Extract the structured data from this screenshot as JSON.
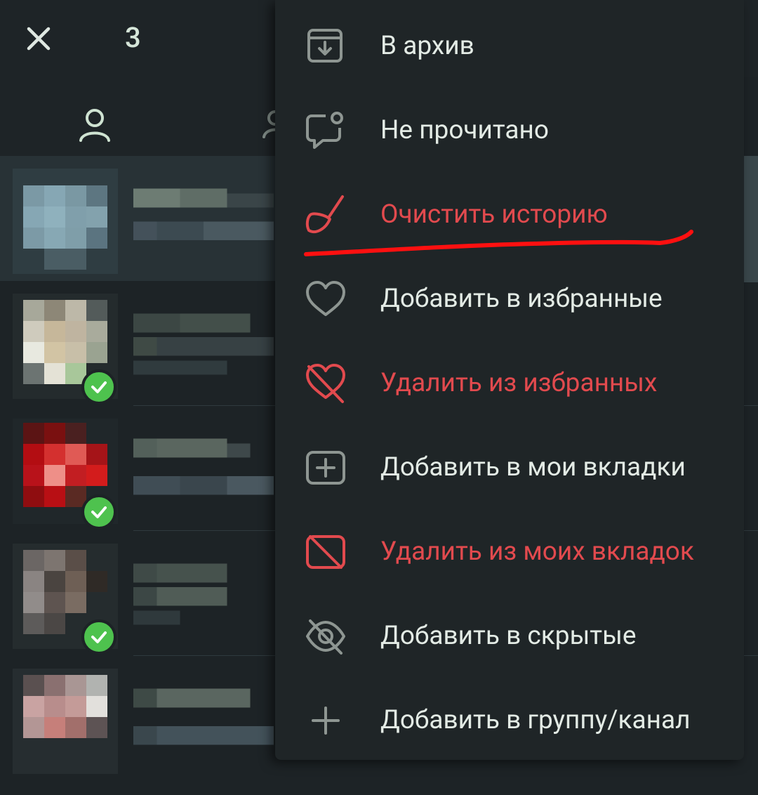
{
  "header": {
    "selected_count": "3",
    "close_icon": "close-icon"
  },
  "tabs": {
    "active_tab_icon": "person-icon"
  },
  "chat_list": {
    "rows": [
      {
        "avatar": "pixelated-avatar",
        "checked": false
      },
      {
        "avatar": "pixelated-avatar",
        "checked": true
      },
      {
        "avatar": "pixelated-avatar",
        "checked": true
      },
      {
        "avatar": "pixelated-avatar",
        "checked": true
      },
      {
        "avatar": "pixelated-avatar",
        "checked": false
      }
    ]
  },
  "menu": {
    "items": [
      {
        "label": "В архив",
        "icon": "archive-icon",
        "danger": false
      },
      {
        "label": "Не прочитано",
        "icon": "unread-chat-icon",
        "danger": false
      },
      {
        "label": "Очистить историю",
        "icon": "broom-icon",
        "danger": true
      },
      {
        "label": "Добавить в избранные",
        "icon": "heart-icon",
        "danger": false
      },
      {
        "label": "Удалить из избранных",
        "icon": "heart-off-icon",
        "danger": true
      },
      {
        "label": "Добавить в мои вкладки",
        "icon": "add-tab-icon",
        "danger": false
      },
      {
        "label": "Удалить из моих вкладок",
        "icon": "remove-tab-icon",
        "danger": true
      },
      {
        "label": "Добавить в скрытые",
        "icon": "eye-off-icon",
        "danger": false
      },
      {
        "label": "Добавить в группу/канал",
        "icon": "plus-icon",
        "danger": false
      }
    ]
  },
  "colors": {
    "background": "#1d2326",
    "menu_background": "#1f2527",
    "text": "#e3ebe5",
    "danger": "#e24a4e",
    "check": "#4ec24e",
    "annotation": "#ff1010"
  }
}
